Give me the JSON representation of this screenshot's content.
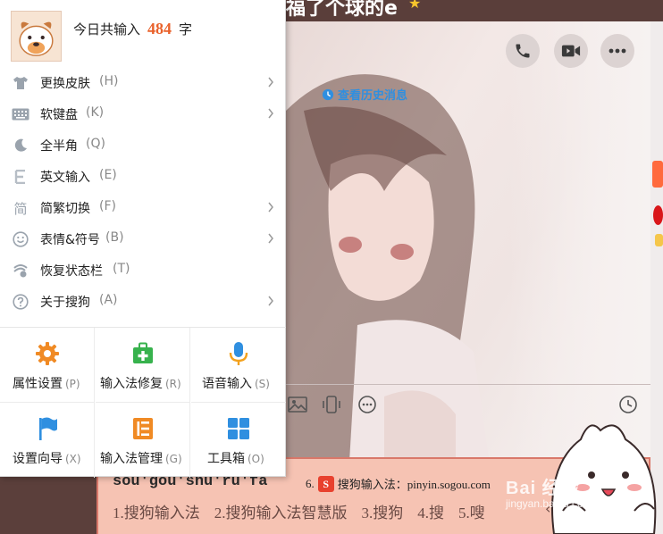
{
  "chat": {
    "title_fragment": "福了个球的e",
    "history_link": "查看历史消息"
  },
  "menu": {
    "header": {
      "prefix": "今日共输入",
      "count": "484",
      "suffix": "字"
    },
    "items": [
      {
        "label": "更换皮肤",
        "key": "(H)",
        "icon": "tshirt-icon",
        "has_submenu": true
      },
      {
        "label": "软键盘",
        "key": "(K)",
        "icon": "keyboard-icon",
        "has_submenu": true
      },
      {
        "label": "全半角",
        "key": "(Q)",
        "icon": "moon-icon",
        "has_submenu": false
      },
      {
        "label": "英文输入",
        "key": "(E)",
        "icon": "letter-e-icon",
        "has_submenu": false
      },
      {
        "label": "简繁切换",
        "key": "(F)",
        "icon": "jian-char-icon",
        "has_submenu": true
      },
      {
        "label": "表情&符号",
        "key": "(B)",
        "icon": "smiley-icon",
        "has_submenu": true
      },
      {
        "label": "恢复状态栏",
        "key": "(T)",
        "icon": "statusbar-restore-icon",
        "has_submenu": false
      },
      {
        "label": "关于搜狗",
        "key": "(A)",
        "icon": "question-circle-icon",
        "has_submenu": true
      }
    ],
    "grid": [
      {
        "label": "属性设置",
        "key": "(P)",
        "icon": "gear-icon"
      },
      {
        "label": "输入法修复",
        "key": "(R)",
        "icon": "repair-kit-icon"
      },
      {
        "label": "语音输入",
        "key": "(S)",
        "icon": "microphone-icon"
      },
      {
        "label": "设置向导",
        "key": "(X)",
        "icon": "flag-icon"
      },
      {
        "label": "输入法管理",
        "key": "(G)",
        "icon": "manager-list-icon"
      },
      {
        "label": "工具箱",
        "key": "(O)",
        "icon": "toolbox-grid-icon"
      }
    ]
  },
  "candidate_bar": {
    "pinyin": "sou'gou'shu'ru'fa",
    "tip_index": "6.",
    "tip_logo": "S",
    "tip_text": "搜狗输入法：pinyin.sogou.com",
    "candidates": [
      "1.搜狗输入法",
      "2.搜狗输入法智慧版",
      "3.搜狗",
      "4.搜",
      "5.嗖"
    ]
  },
  "watermark": {
    "main": "Bai 经验",
    "sub": "jingyan.baidu.com"
  },
  "colors": {
    "accent_orange": "#e9612a",
    "icon_orange": "#f08a24",
    "icon_green": "#37b24d",
    "icon_blue": "#2f8fe0",
    "candidate_bg": "#f6c3b3"
  }
}
